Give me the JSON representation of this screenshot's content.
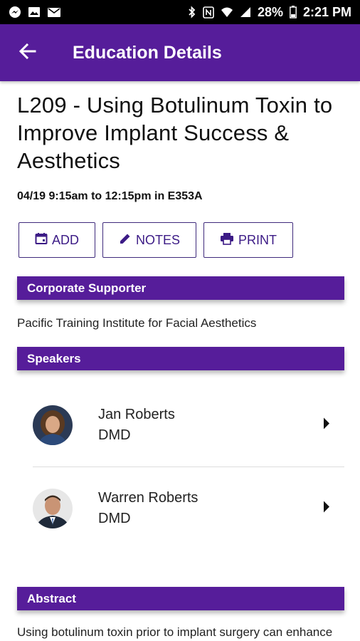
{
  "status_bar": {
    "battery_pct": "28%",
    "time": "2:21 PM",
    "icons_left": [
      "messenger-icon",
      "gallery-icon",
      "mail-icon"
    ],
    "icons_right": [
      "bluetooth-icon",
      "nfc-icon",
      "wifi-icon",
      "signal-icon",
      "battery-icon"
    ]
  },
  "app_bar": {
    "title": "Education Details",
    "back_icon": "arrow-back-icon",
    "color": "#561d9a"
  },
  "session": {
    "title": "L209 - Using Botulinum Toxin to Improve Implant Success & Aesthetics",
    "time_location": "04/19 9:15am to 12:15pm in E353A"
  },
  "actions": {
    "add_label": "ADD",
    "notes_label": "NOTES",
    "print_label": "PRINT"
  },
  "sections": {
    "supporter_heading": "Corporate Supporter",
    "supporter_name": "Pacific Training Institute for Facial Aesthetics",
    "speakers_heading": "Speakers",
    "abstract_heading": "Abstract",
    "abstract_text": "Using botulinum toxin prior to implant surgery can enhance hard and soft tissue grafting success and aid in successful bone regeneration (..."
  },
  "speakers": [
    {
      "name": "Jan Roberts",
      "credential": "DMD"
    },
    {
      "name": "Warren Roberts",
      "credential": "DMD"
    }
  ]
}
